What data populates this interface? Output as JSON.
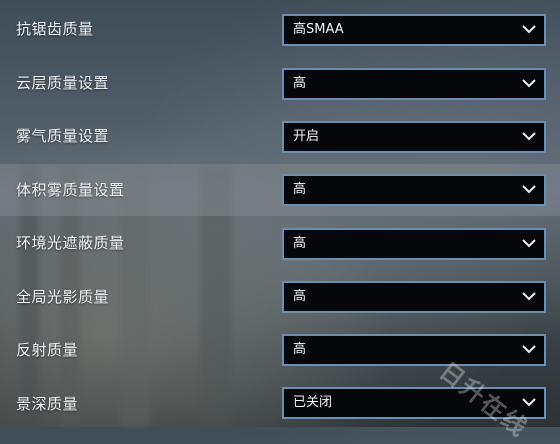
{
  "settings": {
    "items": [
      {
        "label": "抗锯齿质量",
        "value": "高SMAA"
      },
      {
        "label": "云层质量设置",
        "value": "高"
      },
      {
        "label": "雾气质量设置",
        "value": "开启"
      },
      {
        "label": "体积雾质量设置",
        "value": "高"
      },
      {
        "label": "环境光遮蔽质量",
        "value": "高"
      },
      {
        "label": "全局光影质量",
        "value": "高"
      },
      {
        "label": "反射质量",
        "value": "高"
      },
      {
        "label": "景深质量",
        "value": "已关闭"
      }
    ],
    "highlighted_index": 3
  },
  "watermark": "日升在线",
  "colors": {
    "dropdown_border": "#6b8fb3",
    "dropdown_bg": "#05070a",
    "highlight_row": "#8c9296"
  },
  "icons": {
    "dropdown_arrow": "chevron-down-icon"
  }
}
